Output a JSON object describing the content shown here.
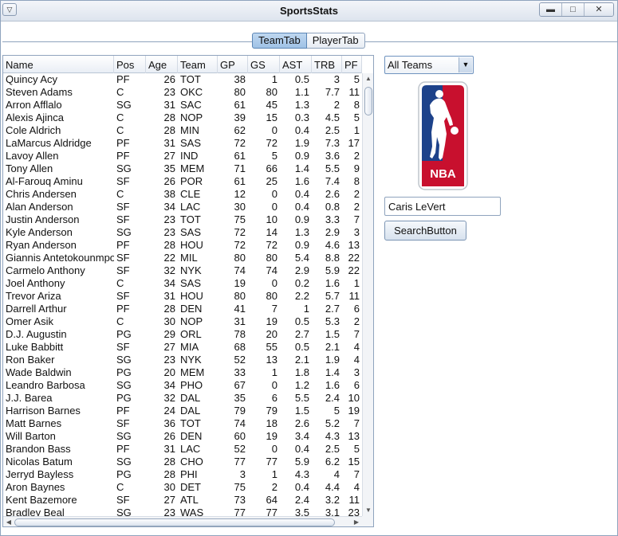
{
  "window": {
    "title": "SportsStats"
  },
  "icons": {
    "system_menu": "chevron-down-icon",
    "minimize": "minimize-icon",
    "maximize": "maximize-icon",
    "close": "close-icon"
  },
  "tabs": [
    {
      "label": "TeamTab",
      "active": true
    },
    {
      "label": "PlayerTab",
      "active": false
    }
  ],
  "table": {
    "headers": [
      "Name",
      "Pos",
      "Age",
      "Team",
      "GP",
      "GS",
      "AST",
      "TRB",
      "PF"
    ],
    "rows": [
      [
        "Quincy Acy",
        "PF",
        "26",
        "TOT",
        "38",
        "1",
        "0.5",
        "3",
        "5"
      ],
      [
        "Steven Adams",
        "C",
        "23",
        "OKC",
        "80",
        "80",
        "1.1",
        "7.7",
        "11"
      ],
      [
        "Arron Afflalo",
        "SG",
        "31",
        "SAC",
        "61",
        "45",
        "1.3",
        "2",
        "8"
      ],
      [
        "Alexis Ajinca",
        "C",
        "28",
        "NOP",
        "39",
        "15",
        "0.3",
        "4.5",
        "5"
      ],
      [
        "Cole Aldrich",
        "C",
        "28",
        "MIN",
        "62",
        "0",
        "0.4",
        "2.5",
        "1"
      ],
      [
        "LaMarcus Aldridge",
        "PF",
        "31",
        "SAS",
        "72",
        "72",
        "1.9",
        "7.3",
        "17"
      ],
      [
        "Lavoy Allen",
        "PF",
        "27",
        "IND",
        "61",
        "5",
        "0.9",
        "3.6",
        "2"
      ],
      [
        "Tony Allen",
        "SG",
        "35",
        "MEM",
        "71",
        "66",
        "1.4",
        "5.5",
        "9"
      ],
      [
        "Al-Farouq Aminu",
        "SF",
        "26",
        "POR",
        "61",
        "25",
        "1.6",
        "7.4",
        "8"
      ],
      [
        "Chris Andersen",
        "C",
        "38",
        "CLE",
        "12",
        "0",
        "0.4",
        "2.6",
        "2"
      ],
      [
        "Alan Anderson",
        "SF",
        "34",
        "LAC",
        "30",
        "0",
        "0.4",
        "0.8",
        "2"
      ],
      [
        "Justin Anderson",
        "SF",
        "23",
        "TOT",
        "75",
        "10",
        "0.9",
        "3.3",
        "7"
      ],
      [
        "Kyle Anderson",
        "SG",
        "23",
        "SAS",
        "72",
        "14",
        "1.3",
        "2.9",
        "3"
      ],
      [
        "Ryan Anderson",
        "PF",
        "28",
        "HOU",
        "72",
        "72",
        "0.9",
        "4.6",
        "13"
      ],
      [
        "Giannis Antetokounmpo",
        "SF",
        "22",
        "MIL",
        "80",
        "80",
        "5.4",
        "8.8",
        "22"
      ],
      [
        "Carmelo Anthony",
        "SF",
        "32",
        "NYK",
        "74",
        "74",
        "2.9",
        "5.9",
        "22"
      ],
      [
        "Joel Anthony",
        "C",
        "34",
        "SAS",
        "19",
        "0",
        "0.2",
        "1.6",
        "1"
      ],
      [
        "Trevor Ariza",
        "SF",
        "31",
        "HOU",
        "80",
        "80",
        "2.2",
        "5.7",
        "11"
      ],
      [
        "Darrell Arthur",
        "PF",
        "28",
        "DEN",
        "41",
        "7",
        "1",
        "2.7",
        "6"
      ],
      [
        "Omer Asik",
        "C",
        "30",
        "NOP",
        "31",
        "19",
        "0.5",
        "5.3",
        "2"
      ],
      [
        "D.J. Augustin",
        "PG",
        "29",
        "ORL",
        "78",
        "20",
        "2.7",
        "1.5",
        "7"
      ],
      [
        "Luke Babbitt",
        "SF",
        "27",
        "MIA",
        "68",
        "55",
        "0.5",
        "2.1",
        "4"
      ],
      [
        "Ron Baker",
        "SG",
        "23",
        "NYK",
        "52",
        "13",
        "2.1",
        "1.9",
        "4"
      ],
      [
        "Wade Baldwin",
        "PG",
        "20",
        "MEM",
        "33",
        "1",
        "1.8",
        "1.4",
        "3"
      ],
      [
        "Leandro Barbosa",
        "SG",
        "34",
        "PHO",
        "67",
        "0",
        "1.2",
        "1.6",
        "6"
      ],
      [
        "J.J. Barea",
        "PG",
        "32",
        "DAL",
        "35",
        "6",
        "5.5",
        "2.4",
        "10"
      ],
      [
        "Harrison Barnes",
        "PF",
        "24",
        "DAL",
        "79",
        "79",
        "1.5",
        "5",
        "19"
      ],
      [
        "Matt Barnes",
        "SF",
        "36",
        "TOT",
        "74",
        "18",
        "2.6",
        "5.2",
        "7"
      ],
      [
        "Will Barton",
        "SG",
        "26",
        "DEN",
        "60",
        "19",
        "3.4",
        "4.3",
        "13"
      ],
      [
        "Brandon Bass",
        "PF",
        "31",
        "LAC",
        "52",
        "0",
        "0.4",
        "2.5",
        "5"
      ],
      [
        "Nicolas Batum",
        "SG",
        "28",
        "CHO",
        "77",
        "77",
        "5.9",
        "6.2",
        "15"
      ],
      [
        "Jerryd Bayless",
        "PG",
        "28",
        "PHI",
        "3",
        "1",
        "4.3",
        "4",
        "7"
      ],
      [
        "Aron Baynes",
        "C",
        "30",
        "DET",
        "75",
        "2",
        "0.4",
        "4.4",
        "4"
      ],
      [
        "Kent Bazemore",
        "SF",
        "27",
        "ATL",
        "73",
        "64",
        "2.4",
        "3.2",
        "11"
      ],
      [
        "Bradley Beal",
        "SG",
        "23",
        "WAS",
        "77",
        "77",
        "3.5",
        "3.1",
        "23"
      ]
    ]
  },
  "team_select": {
    "value": "All Teams",
    "arrow": "chevron-down-icon"
  },
  "logo": {
    "text": "NBA",
    "colors": {
      "blue": "#1d428a",
      "red": "#c8102e"
    }
  },
  "search": {
    "value": "Caris LeVert",
    "button_label": "SearchButton"
  }
}
